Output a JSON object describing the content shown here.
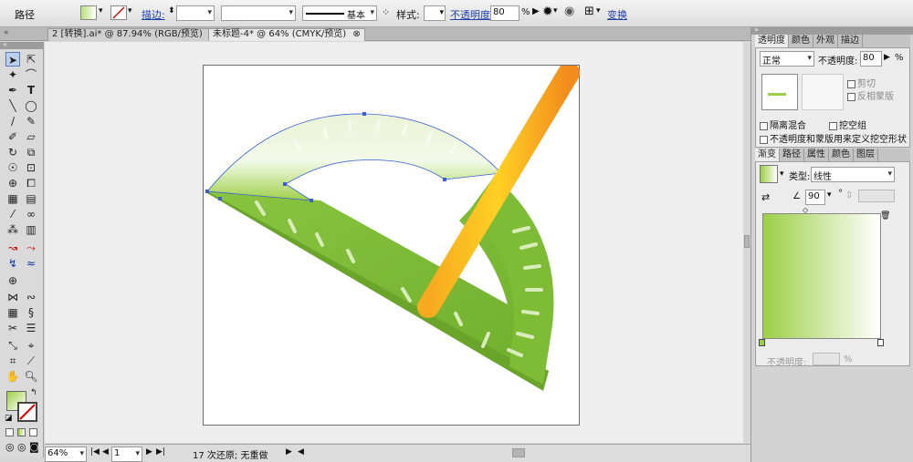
{
  "control_bar": {
    "object_label": "路径",
    "stroke_label": "描边:",
    "stroke_style": "基本",
    "style_label": "样式:",
    "opacity_label": "不透明度:",
    "opacity_value": "80",
    "opacity_unit": "%",
    "transform_label": "变换"
  },
  "tabs": [
    {
      "label": "2 [转换].ai* @ 87.94% (RGB/预览)"
    },
    {
      "label": "未标题-4* @ 64% (CMYK/预览)"
    }
  ],
  "status_bar": {
    "zoom": "64%",
    "artboard_number": "1",
    "history": "17 次还原; 无重做"
  },
  "transparency_panel": {
    "tabs": [
      "透明度",
      "颜色",
      "外观",
      "描边"
    ],
    "blend_mode": "正常",
    "opacity_label": "不透明度:",
    "opacity_value": "80",
    "opacity_unit": "%",
    "clip_label": "剪切",
    "invert_label": "反相蒙版",
    "isolate_label": "隔离混合",
    "knockout_label": "挖空组",
    "opacity_mask_label": "不透明度和蒙版用来定义挖空形状"
  },
  "gradient_panel": {
    "tabs": [
      "渐变",
      "路径",
      "属性",
      "颜色",
      "图层"
    ],
    "type_label": "类型:",
    "type_value": "线性",
    "angle_value": "90",
    "angle_unit": "°",
    "opacity_label": "不透明度:",
    "opacity_unit": "%"
  },
  "colors": {
    "protractor_green": "#8cc63e",
    "protractor_dark": "#6aa42a",
    "pencil_yellow": "#ffd21e",
    "pencil_orange": "#f28a1c",
    "selection_blue": "#3b5fd1",
    "gradient_start": "#9dcf46",
    "gradient_end": "#ffffff"
  }
}
